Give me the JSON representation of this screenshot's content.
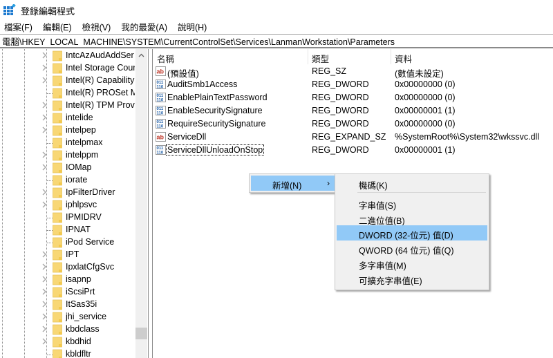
{
  "window": {
    "title": "登錄編輯程式",
    "app_icon": "registry-editor-icon"
  },
  "menu": [
    "檔案(F)",
    "編輯(E)",
    "檢視(V)",
    "我的最愛(A)",
    "說明(H)"
  ],
  "address": {
    "path": "電腦\\HKEY_LOCAL_MACHINE\\SYSTEM\\CurrentControlSet\\Services\\LanmanWorkstation\\Parameters"
  },
  "tree": {
    "items": [
      {
        "label": "IntcAzAudAddSer",
        "expandable": true
      },
      {
        "label": "Intel Storage Cour",
        "expandable": true
      },
      {
        "label": "Intel(R) Capability",
        "expandable": true
      },
      {
        "label": "Intel(R) PROSet M",
        "expandable": false
      },
      {
        "label": "Intel(R) TPM Provi",
        "expandable": true
      },
      {
        "label": "intelide",
        "expandable": true
      },
      {
        "label": "intelpep",
        "expandable": true
      },
      {
        "label": "intelpmax",
        "expandable": false
      },
      {
        "label": "intelppm",
        "expandable": true
      },
      {
        "label": "IOMap",
        "expandable": true
      },
      {
        "label": "iorate",
        "expandable": false
      },
      {
        "label": "IpFilterDriver",
        "expandable": true
      },
      {
        "label": "iphlpsvc",
        "expandable": true
      },
      {
        "label": "IPMIDRV",
        "expandable": false
      },
      {
        "label": "IPNAT",
        "expandable": false
      },
      {
        "label": "iPod Service",
        "expandable": false
      },
      {
        "label": "IPT",
        "expandable": true
      },
      {
        "label": "IpxlatCfgSvc",
        "expandable": true
      },
      {
        "label": "isapnp",
        "expandable": true
      },
      {
        "label": "iScsiPrt",
        "expandable": true
      },
      {
        "label": "ItSas35i",
        "expandable": true
      },
      {
        "label": "jhi_service",
        "expandable": true
      },
      {
        "label": "kbdclass",
        "expandable": true
      },
      {
        "label": "kbdhid",
        "expandable": true
      },
      {
        "label": "kbldfltr",
        "expandable": false
      }
    ]
  },
  "list": {
    "columns": {
      "name": "名稱",
      "type": "類型",
      "data": "資料"
    },
    "rows": [
      {
        "icon": "string-value-icon",
        "name": "(預設值)",
        "type": "REG_SZ",
        "data": "(數值未設定)"
      },
      {
        "icon": "binary-value-icon",
        "name": "AuditSmb1Access",
        "type": "REG_DWORD",
        "data": "0x00000000 (0)"
      },
      {
        "icon": "binary-value-icon",
        "name": "EnablePlainTextPassword",
        "type": "REG_DWORD",
        "data": "0x00000000 (0)"
      },
      {
        "icon": "binary-value-icon",
        "name": "EnableSecuritySignature",
        "type": "REG_DWORD",
        "data": "0x00000001 (1)"
      },
      {
        "icon": "binary-value-icon",
        "name": "RequireSecuritySignature",
        "type": "REG_DWORD",
        "data": "0x00000000 (0)"
      },
      {
        "icon": "string-value-icon",
        "name": "ServiceDll",
        "type": "REG_EXPAND_SZ",
        "data": "%SystemRoot%\\System32\\wkssvc.dll"
      },
      {
        "icon": "binary-value-icon",
        "name": "ServiceDllUnloadOnStop",
        "type": "REG_DWORD",
        "data": "0x00000001 (1)",
        "focused": true
      }
    ]
  },
  "context_menu": {
    "new_label": "新增(N)",
    "arrow": "›",
    "submenu": [
      {
        "label": "機碼(K)"
      },
      {
        "label": "字串值(S)"
      },
      {
        "label": "二進位值(B)"
      },
      {
        "label": "DWORD (32-位元) 值(D)",
        "highlighted": true
      },
      {
        "label": "QWORD (64 位元) 值(Q)"
      },
      {
        "label": "多字串值(M)"
      },
      {
        "label": "可擴充字串值(E)"
      }
    ]
  },
  "colors": {
    "highlight": "#91c9f7",
    "menu_bg": "#f0f0f0",
    "folder": "#f8d775",
    "string_icon": "#c0392b",
    "binary_icon": "#1f5fa8"
  }
}
